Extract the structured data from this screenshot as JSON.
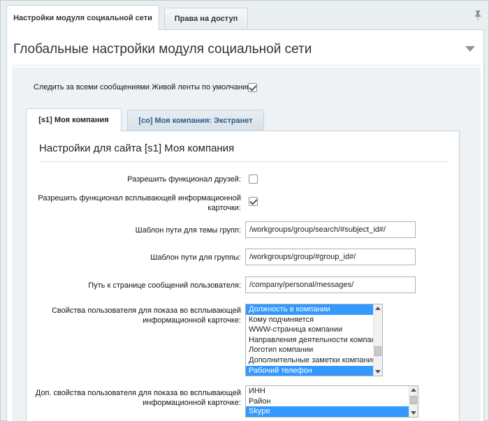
{
  "top_tabs": [
    {
      "label": "Настройки модуля социальной сети"
    },
    {
      "label": "Права на доступ"
    }
  ],
  "section": {
    "title": "Глобальные настройки модуля социальной сети"
  },
  "follow": {
    "label": "Следить за всеми сообщениями Живой ленты по умолчанию:",
    "checked": true
  },
  "site_tabs": [
    {
      "label": "[s1] Моя компания"
    },
    {
      "label": "[co] Моя компания: Экстранет"
    }
  ],
  "site": {
    "title": "Настройки для сайта [s1] Моя компания",
    "friends": {
      "label": "Разрешить функционал друзей:",
      "checked": false
    },
    "popup_card": {
      "label_line1": "Разрешить функционал всплывающей информационной",
      "label_line2": "карточки:",
      "checked": true
    },
    "group_topic_path": {
      "label": "Шаблон пути для темы групп:",
      "value": "/workgroups/group/search/#subject_id#/"
    },
    "group_path": {
      "label": "Шаблон пути для группы:",
      "value": "/workgroups/group/#group_id#/"
    },
    "messages_path": {
      "label": "Путь к странице сообщений пользователя:",
      "value": "/company/personal/messages/"
    },
    "user_props": {
      "label_line1": "Свойства пользователя для показа во всплывающей",
      "label_line2": "информационной карточке:",
      "options": [
        {
          "label": "Должность в компании",
          "selected": true
        },
        {
          "label": "Кому подчиняется",
          "selected": false
        },
        {
          "label": "WWW-страница компании",
          "selected": false
        },
        {
          "label": "Направления деятельности компании",
          "selected": false
        },
        {
          "label": "Логотип компании",
          "selected": false
        },
        {
          "label": "Дополнительные заметки компании",
          "selected": false
        },
        {
          "label": "Рабочий телефон",
          "selected": true
        }
      ]
    },
    "extra_props": {
      "label_line1": "Доп. свойства пользователя для показа во всплывающей",
      "label_line2": "информационной карточке:",
      "options": [
        {
          "label": "ИНН",
          "selected": false
        },
        {
          "label": "Район",
          "selected": false
        },
        {
          "label": "Skype",
          "selected": true
        }
      ]
    }
  },
  "icons": {
    "pin": "pin-icon",
    "collapse": "chevron-down-icon"
  }
}
